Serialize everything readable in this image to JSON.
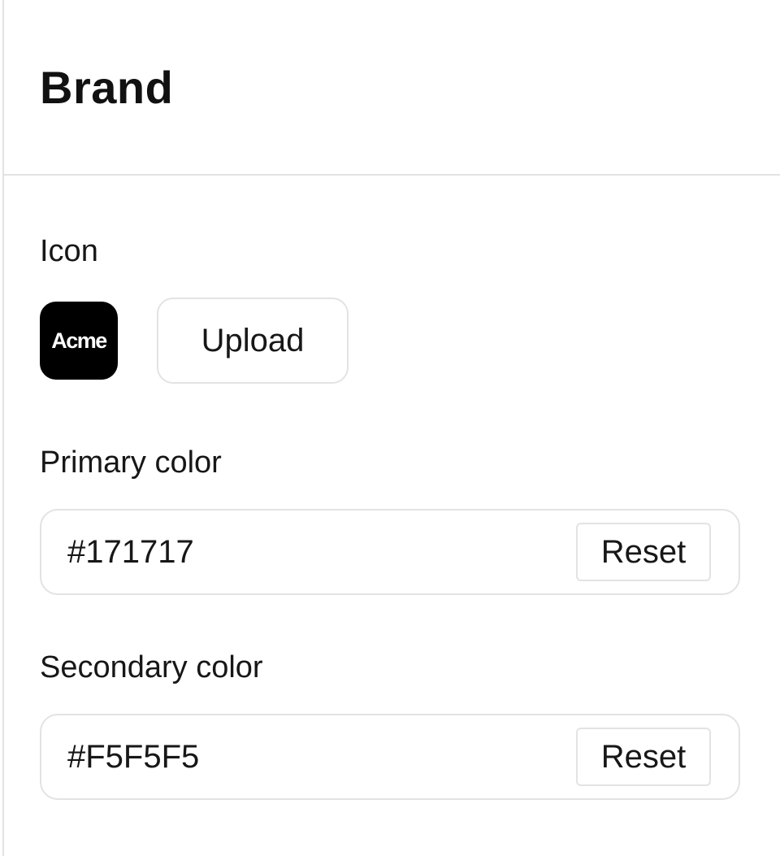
{
  "panel": {
    "title": "Brand"
  },
  "icon_section": {
    "label": "Icon",
    "icon_text": "Acme",
    "icon_background": "#000000",
    "upload_label": "Upload"
  },
  "primary_color": {
    "label": "Primary color",
    "value": "#171717",
    "reset_label": "Reset"
  },
  "secondary_color": {
    "label": "Secondary color",
    "value": "#F5F5F5",
    "reset_label": "Reset"
  },
  "colors": {
    "border": "#e3e3e3",
    "text": "#171717"
  }
}
